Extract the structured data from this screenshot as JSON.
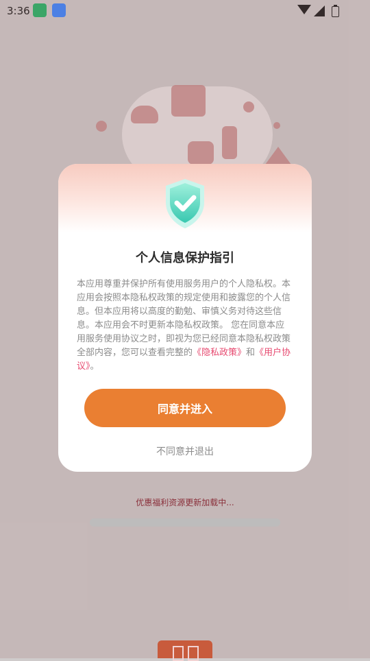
{
  "status_bar": {
    "time": "3:36"
  },
  "dialog": {
    "title": "个人信息保护指引",
    "body_prefix": "本应用尊重并保护所有使用服务用户的个人隐私权。本应用会按照本隐私权政策的规定使用和披露您的个人信息。但本应用将以高度的勤勉、审慎义务对待这些信息。本应用会不时更新本隐私权政策。 您在同意本应用服务使用协议之时，即视为您已经同意本隐私权政策全部内容，您可以查看完整的",
    "privacy_link": "《隐私政策》",
    "connector": "和",
    "user_agreement_link": "《用户协议》",
    "body_suffix": "。",
    "agree_button": "同意并进入",
    "decline_button": "不同意并退出"
  },
  "loading": {
    "text": "优惠福利资源更新加载中..."
  },
  "icons": {
    "shield": "shield-check-icon",
    "wifi": "wifi-icon",
    "signal": "signal-icon",
    "battery": "battery-icon"
  },
  "colors": {
    "accent_orange": "#ea7f32",
    "link_pink": "#e74a70",
    "dialog_top": "#f7cbc0",
    "loading_text": "#8a2f3a"
  }
}
